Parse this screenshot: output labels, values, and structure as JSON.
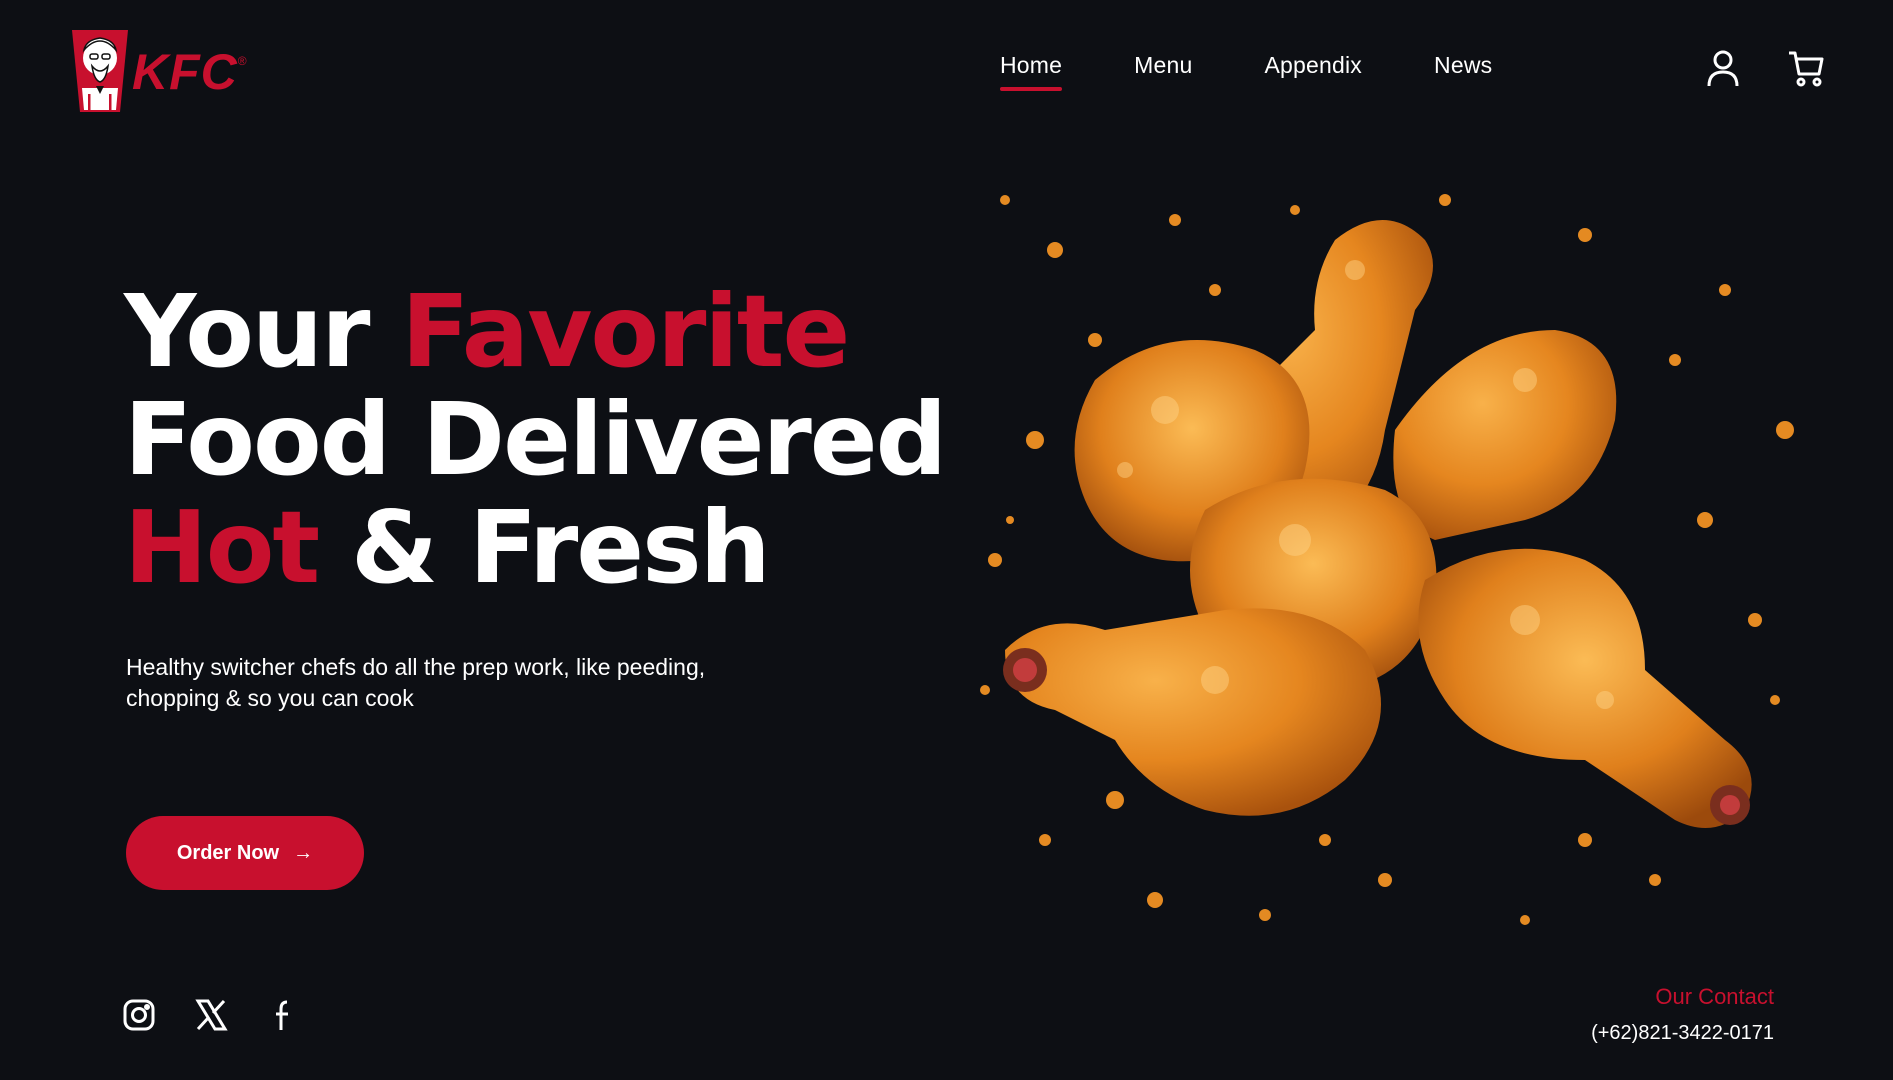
{
  "brand": {
    "logo_text": "KFC",
    "registered_mark": "®",
    "accent_color": "#c8102e",
    "background_color": "#0d0f14"
  },
  "nav": {
    "items": [
      {
        "label": "Home",
        "active": true
      },
      {
        "label": "Menu",
        "active": false
      },
      {
        "label": "Appendix",
        "active": false
      },
      {
        "label": "News",
        "active": false
      }
    ]
  },
  "header_icons": [
    "user-icon",
    "cart-icon"
  ],
  "hero": {
    "headline": {
      "line1_white": "Your",
      "line1_red": "Favorite",
      "line2_white": "Food Delivered",
      "line3_red": "Hot",
      "line3_white": "& Fresh"
    },
    "subtitle": "Healthy switcher chefs do all the prep work, like peeding, chopping & so you can cook",
    "cta_label": "Order Now",
    "cta_icon": "arrow-right-icon",
    "image": "fried-chicken-drumsticks"
  },
  "social": [
    "instagram-icon",
    "x-icon",
    "facebook-icon"
  ],
  "contact": {
    "label": "Our Contact",
    "phone": "(+62)821-3422-0171"
  }
}
